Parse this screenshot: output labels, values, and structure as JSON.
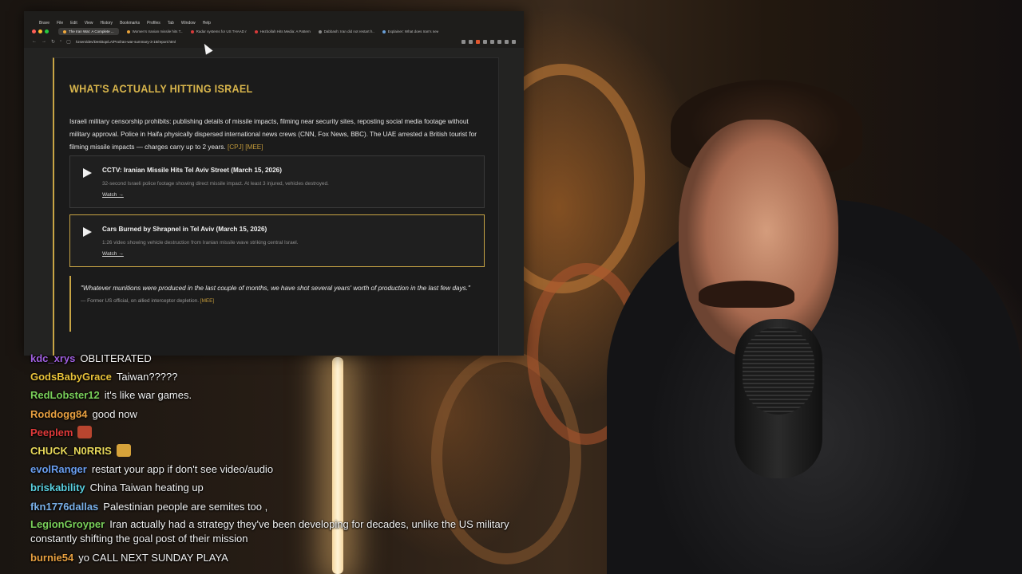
{
  "browser": {
    "menu": [
      "",
      "Brave",
      "File",
      "Edit",
      "View",
      "History",
      "Bookmarks",
      "Profiles",
      "Tab",
      "Window",
      "Help"
    ],
    "tabs": [
      {
        "label": "The Iran War: A Complete ...",
        "active": true,
        "color": "#f2a93b"
      },
      {
        "label": "Women's Iranian missile hits T...",
        "active": false,
        "color": "#e7a23a"
      },
      {
        "label": "Radar systems for US THAAD m...",
        "active": false,
        "color": "#d83a3a"
      },
      {
        "label": "Hezbollah Hits Media: A Pattern...",
        "active": false,
        "color": "#d83a3a"
      },
      {
        "label": "Dabbash: Iran did not restart h...",
        "active": false,
        "color": "#8a8a8a"
      },
      {
        "label": "Explainer: What does Iran's new ...",
        "active": false,
        "color": "#6aa0d8"
      }
    ],
    "url": "/Users/dev/Desktop/LA/Pro/iran-war-summary-3-15/report.html"
  },
  "page": {
    "section_title": "WHAT'S ACTUALLY HITTING ISRAEL",
    "intro": "Israeli military censorship prohibits: publishing details of missile impacts, filming near security sites, reposting social media footage without military approval. Police in Haifa physically dispersed international news crews (CNN, Fox News, BBC). The UAE arrested a British tourist for filming missile impacts — charges carry up to 2 years.",
    "intro_cites": [
      "[CPJ]",
      "[MEE]"
    ],
    "videos": [
      {
        "title": "CCTV: Iranian Missile Hits Tel Aviv Street (March 15, 2026)",
        "desc": "32-second Israeli police footage showing direct missile impact. At least 3 injured, vehicles destroyed.",
        "link": "Watch →"
      },
      {
        "title": "Cars Burned by Shrapnel in Tel Aviv (March 15, 2026)",
        "desc": "1:26 video showing vehicle destruction from Iranian missile wave striking central Israel.",
        "link": "Watch →"
      }
    ],
    "quote": {
      "text": "\"Whatever munitions were produced in the last couple of months, we have shot several years' worth of production in the last few days.\"",
      "attribution": "— Former US official, on allied interceptor depletion.",
      "cite": "[MEE]"
    }
  },
  "chat": [
    {
      "user": "kdc_xrys",
      "color": "#a060e0",
      "text": "OBLITERATED"
    },
    {
      "user": "GodsBabyGrace",
      "color": "#e8c23a",
      "text": "Taiwan?????"
    },
    {
      "user": "RedLobster12",
      "color": "#7ad05a",
      "text": "it's like war games."
    },
    {
      "user": "Roddogg84",
      "color": "#e8a040",
      "text": "good now"
    },
    {
      "user": "Peeplem",
      "color": "#e03a3a",
      "text": "",
      "emote": "emote"
    },
    {
      "user": "CHUCK_N0RRIS",
      "color": "#e8d85a",
      "text": "",
      "emote": "emote"
    },
    {
      "user": "evolRanger",
      "color": "#6a9ef0",
      "text": "restart your app if don't see video/audio"
    },
    {
      "user": "briskability",
      "color": "#5ad0e0",
      "text": "China Taiwan heating up"
    },
    {
      "user": "fkn1776dallas",
      "color": "#7ab0e8",
      "text": "Palestinian people are semites too ,"
    },
    {
      "user": "LegionGroyper",
      "color": "#7ad05a",
      "text": "Iran actually had a strategy they've been developing for decades, unlike the US military constantly shifting the goal post of their mission"
    },
    {
      "user": "burnie54",
      "color": "#e8a040",
      "text": "yo CALL NEXT SUNDAY PLAYA"
    }
  ]
}
